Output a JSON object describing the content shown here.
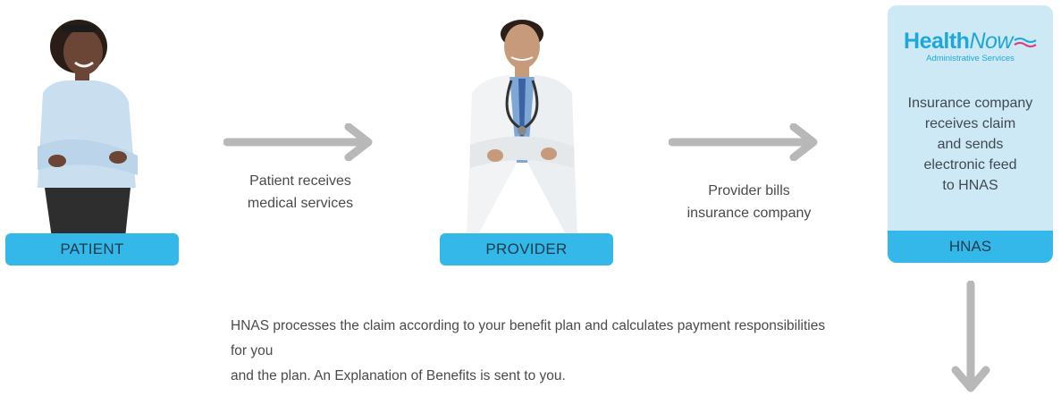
{
  "patient": {
    "label": "PATIENT",
    "icon": "patient-person-icon"
  },
  "step1": {
    "line1": "Patient receives",
    "line2": "medical services"
  },
  "provider": {
    "label": "PROVIDER",
    "icon": "doctor-person-icon"
  },
  "step2": {
    "line1": "Provider bills",
    "line2": "insurance company"
  },
  "hnas": {
    "logo_main": "Health",
    "logo_now": "Now",
    "logo_sub": "Administrative Services",
    "line1": "Insurance company",
    "line2": "receives claim",
    "line3": "and sends",
    "line4": "electronic feed",
    "line5": "to HNAS",
    "label": "HNAS"
  },
  "description": {
    "line1": "HNAS processes the claim according to your benefit plan and calculates payment responsibilities for you",
    "line2": "and the plan. An Explanation of Benefits is sent to you."
  },
  "colors": {
    "accent": "#34b8ea",
    "card_bg": "#cde9f5",
    "arrow": "#b8b8b8",
    "text": "#4a4a4a"
  }
}
